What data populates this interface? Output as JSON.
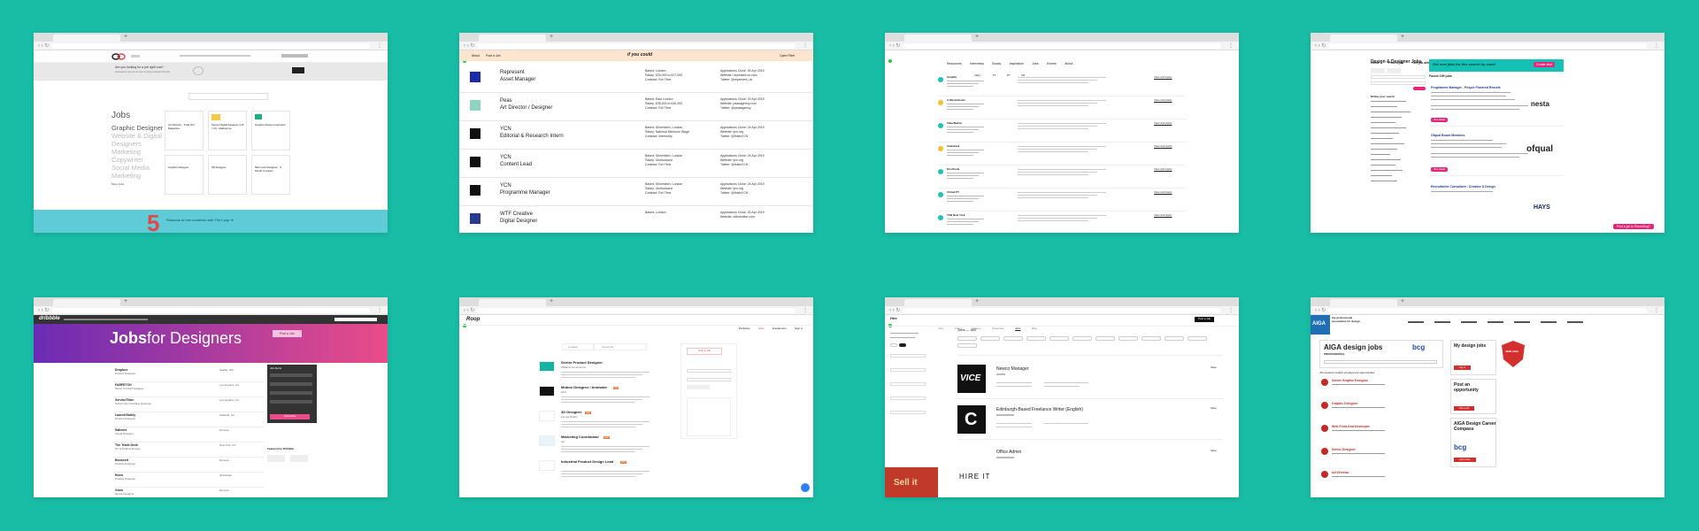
{
  "browser": {
    "new_tab_symbol": "+",
    "nav_symbols": "‹ › ↻",
    "menu_symbol": "⋮"
  },
  "w1": {
    "hero_question": "Are you looking for a job right now?",
    "hero_sub": "Jobseekers may not be open to being contacted for jobs",
    "side_title": "Jobs",
    "categories": [
      "Graphic Designer",
      "Website & Digital",
      "Designers",
      "Marketing",
      "Copywriter",
      "Social Media",
      "Marketing"
    ],
    "view_all": "More Jobs",
    "cards": [
      {
        "title": "Art Director - Total Girl Magazine"
      },
      {
        "title": "Senior Digital Designer (UX / UI) - Melbourne"
      },
      {
        "title": "Graphic Design Internship"
      },
      {
        "title": "Graphic Designer"
      },
      {
        "title": "3D Designer"
      },
      {
        "title": "Mid Level Designer - 6 Month Contract"
      }
    ],
    "band_number": "5",
    "band_text": "Reasons to hire creatives with The Loop  ➜"
  },
  "w2": {
    "nav": [
      "About",
      "Post a Job"
    ],
    "open_filter": "Open Filter",
    "logo_text": "if you could",
    "rows": [
      {
        "company": "Represent",
        "role": "Asset Manager",
        "details": [
          "Based: London",
          "Salary: £25,000 to £27,000",
          "Contract: Full Time"
        ],
        "meta": [
          "Applications Close: 30 Apr 2019",
          "Website: represent.uk.com",
          "Twitter: @represent_uk"
        ],
        "logo": "#1c2aa8"
      },
      {
        "company": "Peas",
        "role": "Art Director / Designer",
        "details": [
          "Based: East London",
          "Salary: £35,000 to £40,000",
          "Contract: Full Time"
        ],
        "meta": [
          "Applications Close: 20 Apr 2019",
          "Website: peasagency.com",
          "Twitter: @peasagency"
        ],
        "logo": "#8fd3c2"
      },
      {
        "company": "YCN",
        "role": "Editorial & Research Intern",
        "details": [
          "Based: Shoreditch, London",
          "Salary: National Minimum Wage",
          "Contract: Internship"
        ],
        "meta": [
          "Applications Close: 24 Apr 2019",
          "Website: ycn.org",
          "Twitter: @thisisYCN"
        ],
        "logo": "#111111"
      },
      {
        "company": "YCN",
        "role": "Content Lead",
        "details": [
          "Based: Shoreditch, London",
          "Salary: Undisclosed",
          "Contract: Full Time"
        ],
        "meta": [
          "Applications Close: 24 Apr 2019",
          "Website: ycn.org",
          "Twitter: @thisisYCN"
        ],
        "logo": "#111111"
      },
      {
        "company": "YCN",
        "role": "Programme Manager",
        "details": [
          "Based: Shoreditch, London",
          "Salary: Undisclosed",
          "Contract: Full Time"
        ],
        "meta": [
          "Applications Close: 24 Apr 2019",
          "Website: ycn.org",
          "Twitter: @thisisYCN"
        ],
        "logo": "#111111"
      },
      {
        "company": "WTF Creative",
        "role": "Digital Designer",
        "details": [
          "Based: London",
          "",
          ""
        ],
        "meta": [
          "Applications Close: 30 Apr 2019",
          "Website: wtfcreative.com",
          ""
        ],
        "logo": "#2a3b8f"
      }
    ]
  },
  "w3": {
    "nav": [
      "Resources",
      "Interviews",
      "Books",
      "Inspiration",
      "Jobs",
      "Events",
      "About"
    ],
    "filters": [
      "ALL",
      "FT",
      "PT",
      "FR"
    ],
    "view_link": "View and Apply",
    "rows": [
      {
        "title": "Amplify",
        "color": "#1ec2b6"
      },
      {
        "title": "A Westminster",
        "color": "#f2c230"
      },
      {
        "title": "ValueNation",
        "color": "#1ec2b6"
      },
      {
        "title": "Vuelaloud",
        "color": "#f2c230"
      },
      {
        "title": "KnotCode",
        "color": "#1ec2b6"
      },
      {
        "title": "Virtual PY",
        "color": "#1ec2b6"
      },
      {
        "title": "TCB New York",
        "color": "#1ec2b6"
      }
    ]
  },
  "w4": {
    "nav": [
      "Home",
      "Post a job",
      "Get job alerts",
      "Search recruiters",
      "Careers advice"
    ],
    "title": "Design & Designer Jobs",
    "banner_text": "Get new jobs for this search by email",
    "banner_button": "Create alert",
    "found": "Found 199 jobs",
    "refine": "Refine your search",
    "jobs": [
      {
        "title": "Programme Manager - People Powered Results",
        "logo": "nesta"
      },
      {
        "title": "Ofqual Board Members",
        "logo": "ofqual"
      },
      {
        "title": "Recruitment Consultant - Creative & Design",
        "logo": "HAYS"
      }
    ],
    "feedback": "Find a job in Recruiting?",
    "button_label": "View details"
  },
  "w5": {
    "logo": "dribbble",
    "hero_title": "Jobs",
    "hero_title2": " for Designers",
    "post_button": "Post a Job",
    "rows": [
      {
        "company": "Dropbox",
        "role": "Product Designer",
        "location": "Seattle, WA"
      },
      {
        "company": "FARFETCH",
        "role": "Senior Product Designer",
        "location": "Los Angeles, CA"
      },
      {
        "company": "ServiceTitan",
        "role": "Senior User Interface Designer",
        "location": "Los Angeles, CA"
      },
      {
        "company": "LaunchDarkly",
        "role": "Product Designer",
        "location": "Oakland, CA"
      },
      {
        "company": "Saliente",
        "role": "Visual Designer",
        "location": "Remote"
      },
      {
        "company": "The Trade Desk",
        "role": "UX & Product Design",
        "location": "New York, NY"
      },
      {
        "company": "Bounceit",
        "role": "Product Designer",
        "location": "Remote"
      },
      {
        "company": "Etoro",
        "role": "Product Designer",
        "location": "Worldwide"
      },
      {
        "company": "Grow",
        "role": "Senior Designer",
        "location": "Remote"
      }
    ],
    "side_title": "Job Alerts",
    "side_button": "Subscribe",
    "featured": "Featured by Dribbble"
  },
  "w6": {
    "logo": "Roop",
    "nav": [
      "Portfolios",
      "Jobs",
      "Freelancers",
      "Sign in"
    ],
    "filters": [
      "Location",
      "Keywords"
    ],
    "post_button": "Post a Job",
    "rows": [
      {
        "title": "Senior Product Designer",
        "company": "Williams-Sonoma Inc.",
        "logo_color": "#16b3a3",
        "badge": ""
      },
      {
        "title": "Motion Designer / Animator",
        "company": "AKG",
        "logo_color": "#111111",
        "badge": "new"
      },
      {
        "title": "3D Designer",
        "company": "Lampa Studio",
        "logo_color": "#ffffff",
        "badge": "new"
      },
      {
        "title": "Marketing Coordinator",
        "company": "dvi",
        "logo_color": "#e8f4fb",
        "badge": "new"
      },
      {
        "title": "Industrial Product Design Lead",
        "company": "",
        "logo_color": "#ffffff",
        "badge": "new"
      }
    ]
  },
  "w7": {
    "logo": "Hire",
    "nav": [
      "Jobs",
      "Talent",
      "Places",
      "Showcase",
      "Jobs",
      "Blog"
    ],
    "post_button": "Post a Job",
    "heading": "Jobs — 800",
    "jobs": [
      {
        "title": "Newco Manager",
        "logo": "VICE",
        "save": "Save"
      },
      {
        "title": "Edinburgh-Based Freelance Writer (English)",
        "logo": "C",
        "save": "Save"
      },
      {
        "title": "Office Admin",
        "logo": "HIRE IT",
        "save": "Save"
      }
    ],
    "promo": "Sell it"
  },
  "w8": {
    "logo": "AIGA",
    "logo_sub": "the professional association for design",
    "title": "AIGA design jobs",
    "title_sub": "PROFESSIONAL",
    "partner": "bcg",
    "list_heading": "Job-centred creative employment opportunities",
    "jobs": [
      "Senior Graphic Designer",
      "Graphic Designer",
      "Web Front-End Developer",
      "Senior Designer",
      "Art Director"
    ],
    "side_boxes": [
      {
        "title": "My design jobs",
        "button": "Log in"
      },
      {
        "title": "Post an opportunity",
        "button": "Post a job"
      },
      {
        "title": "AIGA Design Career Compass",
        "button": "Learn more"
      }
    ],
    "join_badge": "JOIN AIGA"
  }
}
